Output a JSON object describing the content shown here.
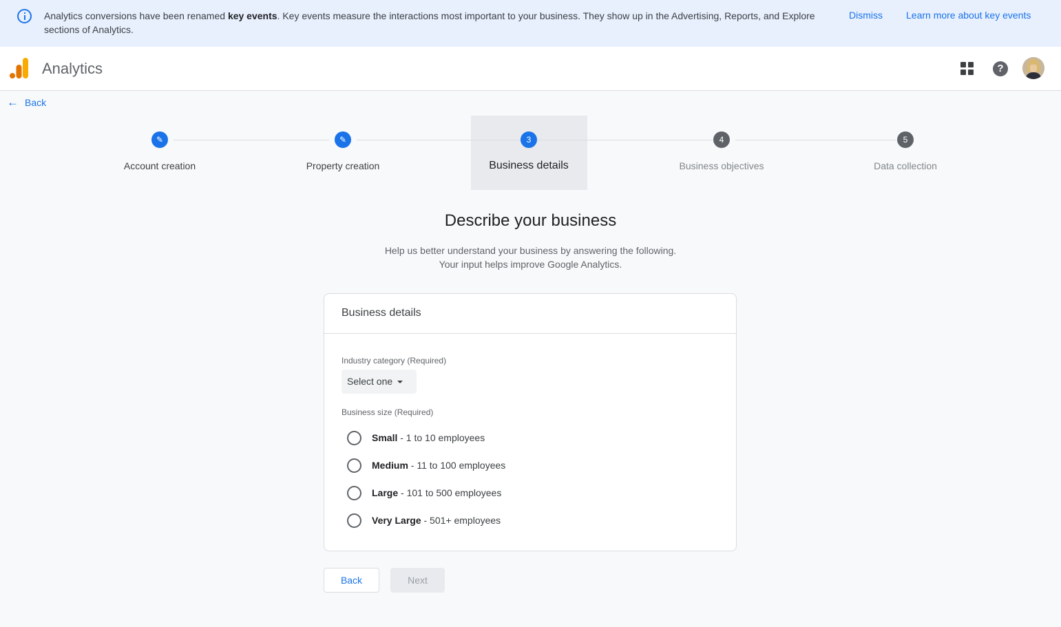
{
  "banner": {
    "icon": "info-icon",
    "text_before": "Analytics conversions have been renamed ",
    "text_bold": "key events",
    "text_after": ". Key events measure the interactions most important to your business. They show up in the Advertising, Reports, and Explore sections of Analytics.",
    "dismiss_label": "Dismiss",
    "learn_more_label": "Learn more about key events"
  },
  "header": {
    "app_name": "Analytics",
    "icons": [
      "analytics-logo",
      "apps-grid-icon",
      "help-icon",
      "avatar"
    ],
    "help_glyph": "?"
  },
  "nav": {
    "back_label": "Back",
    "back_arrow": "←"
  },
  "stepper": {
    "steps": [
      {
        "number": "1",
        "label": "Account creation",
        "state": "done",
        "glyph": "✎"
      },
      {
        "number": "2",
        "label": "Property creation",
        "state": "done",
        "glyph": "✎"
      },
      {
        "number": "3",
        "label": "Business details",
        "state": "current",
        "glyph": "3"
      },
      {
        "number": "4",
        "label": "Business objectives",
        "state": "todo",
        "glyph": "4"
      },
      {
        "number": "5",
        "label": "Data collection",
        "state": "todo",
        "glyph": "5"
      }
    ]
  },
  "main": {
    "title": "Describe your business",
    "subtitle_line1": "Help us better understand your business by answering the following.",
    "subtitle_line2": "Your input helps improve Google Analytics."
  },
  "card": {
    "title": "Business details",
    "industry": {
      "label": "Industry category (Required)",
      "selected": "Select one"
    },
    "size": {
      "label": "Business size (Required)",
      "options": [
        {
          "name": "Small",
          "detail": " - 1 to 10 employees",
          "checked": false
        },
        {
          "name": "Medium",
          "detail": " - 11 to 100 employees",
          "checked": false
        },
        {
          "name": "Large",
          "detail": " - 101 to 500 employees",
          "checked": false
        },
        {
          "name": "Very Large",
          "detail": " - 501+ employees",
          "checked": false
        }
      ]
    }
  },
  "footer": {
    "back_label": "Back",
    "next_label": "Next",
    "next_enabled": false
  },
  "colors": {
    "accent": "#1a73e8",
    "banner_bg": "#e8f0fe",
    "page_bg": "#f8f9fa",
    "logo_orange": "#f9ab00",
    "logo_dark_orange": "#e37400"
  }
}
